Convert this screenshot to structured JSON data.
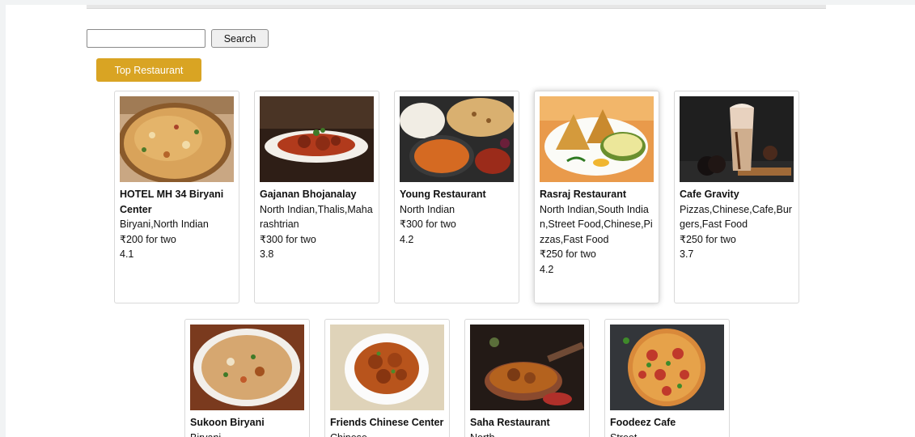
{
  "search": {
    "value": "",
    "placeholder": "",
    "button_label": "Search"
  },
  "top_restaurant_label": "Top Restaurant",
  "restaurants": [
    {
      "name": "HOTEL MH 34 Biryani Center",
      "cuisines": "Biryani,North Indian",
      "cost": "₹200 for two",
      "rating": "4.1",
      "image": "biryani-plate"
    },
    {
      "name": "Gajanan Bhojanalay",
      "cuisines": "North Indian,Thalis,Maharashtrian",
      "cost": "₹300 for two",
      "rating": "3.8",
      "image": "curry-dish"
    },
    {
      "name": "Young Restaurant",
      "cuisines": "North Indian",
      "cost": "₹300 for two",
      "rating": "4.2",
      "image": "naan-rice-curry"
    },
    {
      "name": "Rasraj Restaurant",
      "cuisines": "North Indian,South Indian,Street Food,Chinese,Pizzas,Fast Food",
      "cost": "₹250 for two",
      "rating": "4.2",
      "image": "samosa-plate"
    },
    {
      "name": "Cafe Gravity",
      "cuisines": "Pizzas,Chinese,Cafe,Burgers,Fast Food",
      "cost": "₹250 for two",
      "rating": "3.7",
      "image": "cold-coffee"
    },
    {
      "name": "Sukoon Biryani",
      "cuisines": "Biryani",
      "image": "biryani-bowl"
    },
    {
      "name": "Friends Chinese Center",
      "cuisines": "Chinese",
      "image": "manchurian-bowl"
    },
    {
      "name": "Saha Restaurant",
      "cuisines": "North",
      "image": "pan-curry"
    },
    {
      "name": "Foodeez Cafe",
      "cuisines": "Street",
      "image": "pizza"
    }
  ]
}
